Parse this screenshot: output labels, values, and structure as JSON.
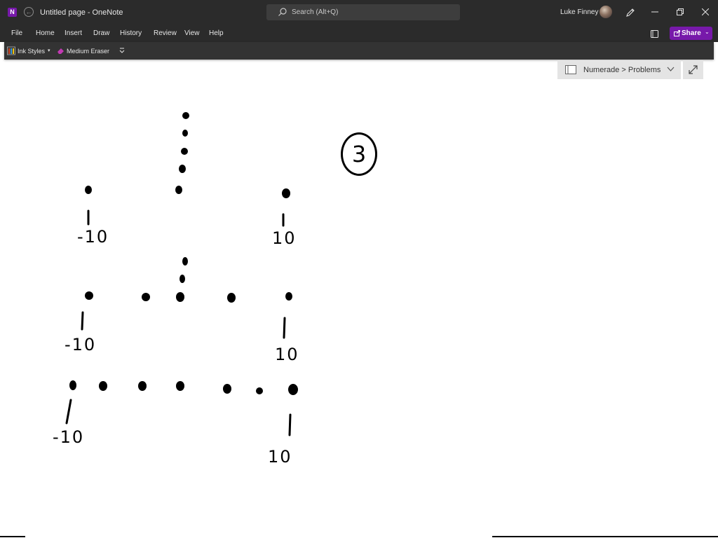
{
  "titlebar": {
    "app_icon": "onenote-icon",
    "page_title": "Untitled page",
    "separator": "-",
    "app_name": "OneNote",
    "search_placeholder": "Search (Alt+Q)",
    "user_name": "Luke Finney"
  },
  "menu": {
    "items": [
      "File",
      "Home",
      "Insert",
      "Draw",
      "History",
      "Review",
      "View",
      "Help"
    ],
    "share_label": "Share"
  },
  "ribbon": {
    "ink_styles_label": "Ink Styles",
    "eraser_label": "Medium Eraser"
  },
  "location": {
    "breadcrumb": "Numerade > Problems"
  },
  "canvas": {
    "circled_number": "3",
    "labels": [
      "-10",
      "10",
      "-10",
      "10",
      "-10",
      "10"
    ]
  },
  "colors": {
    "titlebar_bg": "#2b2b2b",
    "ribbon_bg": "#333333",
    "accent": "#7719aa",
    "ink": "#000000",
    "page_bg": "#ffffff"
  }
}
